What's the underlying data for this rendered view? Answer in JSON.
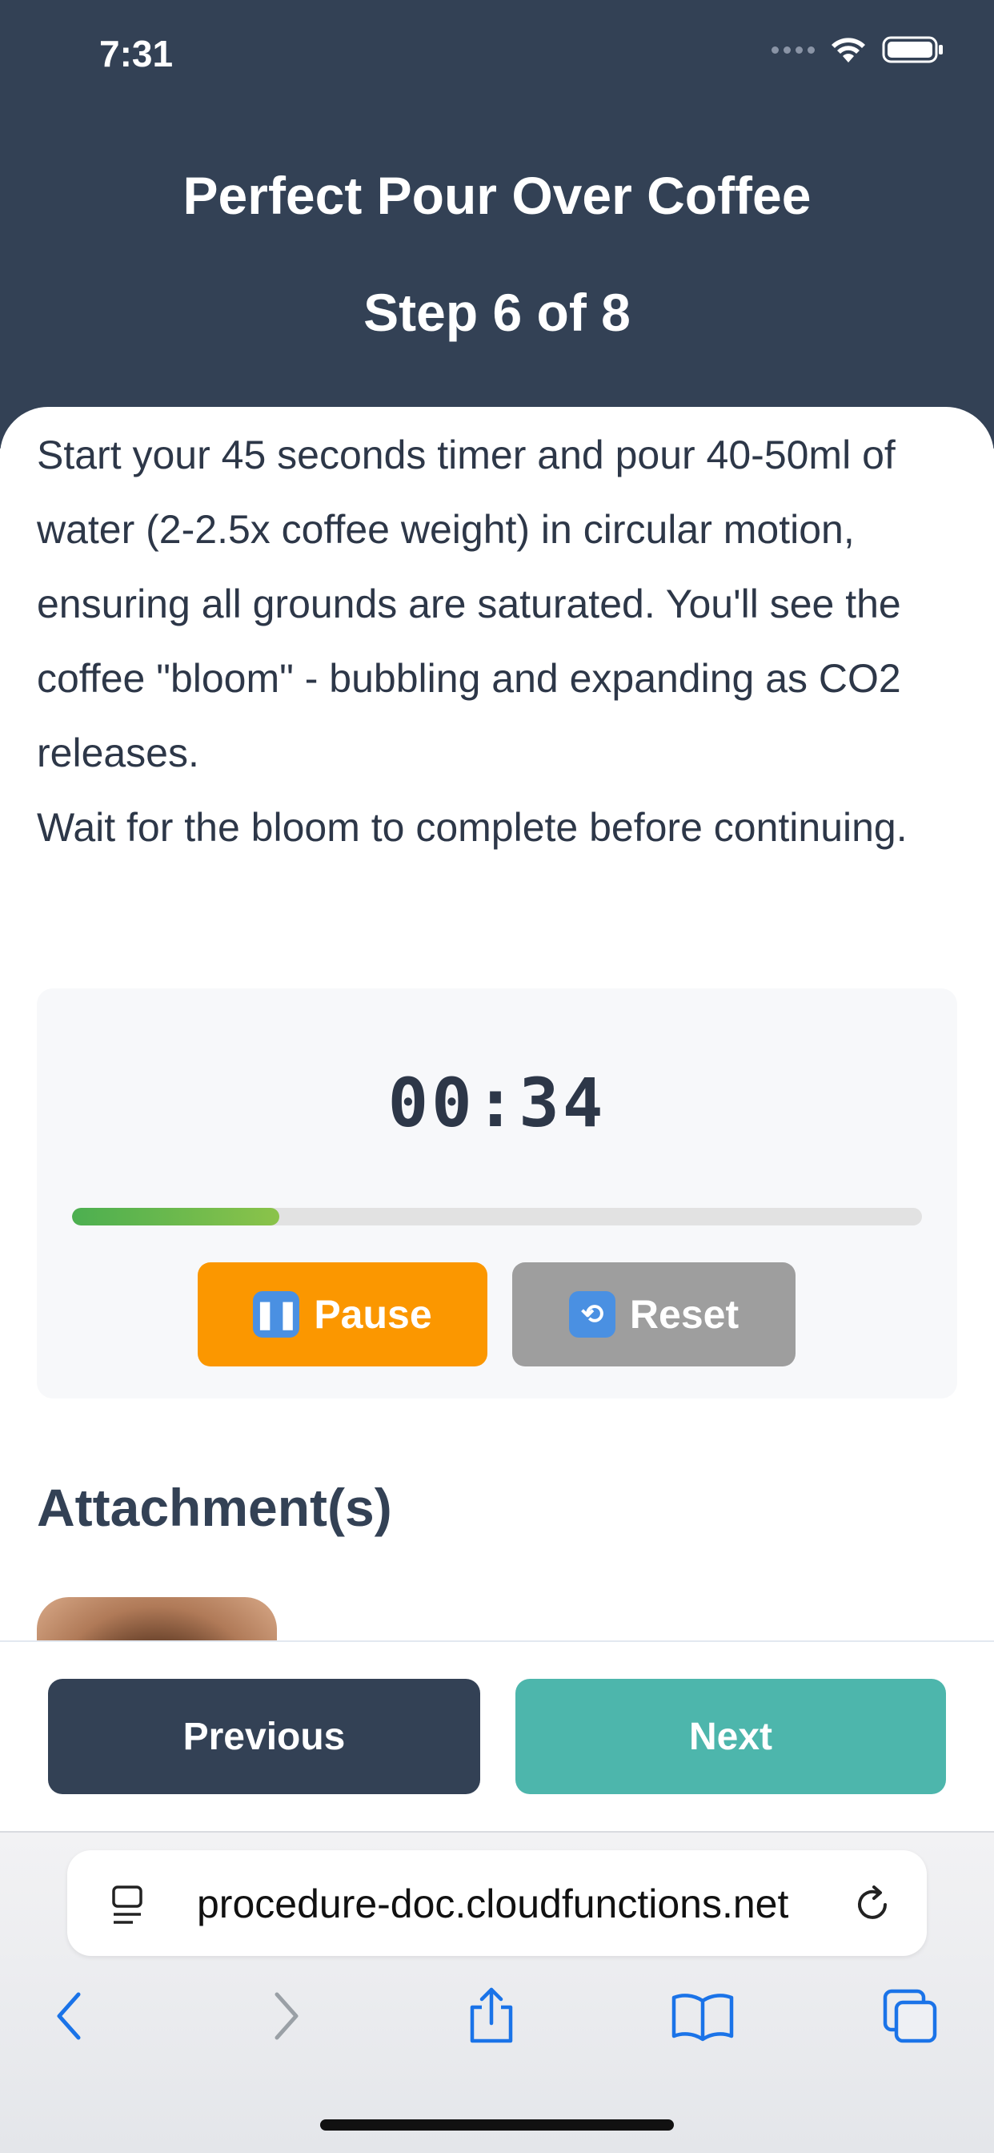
{
  "status_bar": {
    "time": "7:31"
  },
  "header": {
    "title": "Perfect Pour Over Coffee",
    "step": "Step 6 of 8"
  },
  "instructions": {
    "paragraph1": "Start your 45 seconds timer and pour 40-50ml of water (2-2.5x coffee weight) in circular motion, ensuring all grounds are saturated. You'll see the coffee \"bloom\" - bubbling and expanding as CO2 releases.",
    "paragraph2": "Wait for the bloom to complete before continuing."
  },
  "timer": {
    "display": "00:34",
    "progress_percent": 24.4,
    "pause_label": "Pause",
    "pause_icon": "pause-emoji-icon",
    "reset_label": "Reset",
    "reset_icon": "counterclockwise-arrows-emoji-icon",
    "pause_color": "#fb9700",
    "reset_color": "#9e9e9e"
  },
  "attachments": {
    "title": "Attachment(s)"
  },
  "navigation": {
    "previous_label": "Previous",
    "next_label": "Next",
    "previous_color": "#334155",
    "next_color": "#4db6ac"
  },
  "browser": {
    "url": "procedure-doc.cloudfunctions.net",
    "toolbar_icons": [
      "back-icon",
      "forward-icon",
      "share-icon",
      "bookmarks-icon",
      "tabs-icon"
    ]
  },
  "colors": {
    "header_bg": "#334155",
    "accent_green": "#4caf50"
  }
}
